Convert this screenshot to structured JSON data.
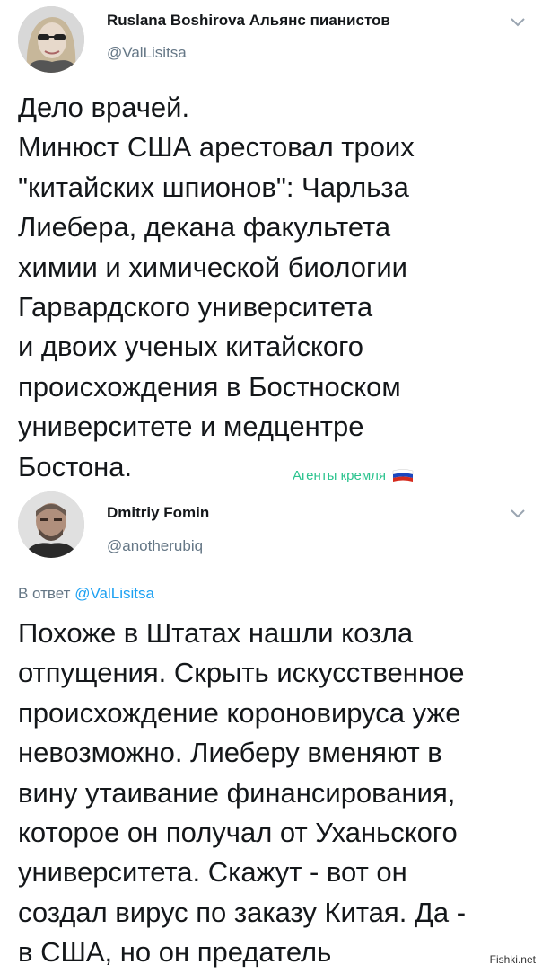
{
  "tweets": [
    {
      "author_name": "Ruslana Boshirova Альянс пианистов",
      "handle": "@ValLisitsa",
      "text": "Дело врачей.\nМинюст США арестовал троих\n\"китайских шпионов\": Чарльза\nЛиебера, декана факультета\nхимии и химической биологии\nГарвардского университета\nи двоих ученых китайского\nпроисхождения в Бостноском\nуниверситете и медцентре\nБостона.",
      "stamp": "Агенты кремля"
    },
    {
      "author_name": "Dmitriy Fomin",
      "handle": "@anotherubiq",
      "reply_prefix": "В ответ",
      "reply_to": "@ValLisitsa",
      "text": "Похоже в Штатах нашли козла\nотпущения. Скрыть искусственное\nпроисхождение короновируса уже\nневозможно. Лиеберу вменяют в\nвину утаивание финансирования,\nкоторое он получал от Уханьского\nуниверситета. Скажут -  вот  он\nсоздал вирус по заказу Китая. Да -\nв США, но он предатель"
    }
  ],
  "watermark": "Fishki.net",
  "colors": {
    "text": "#14171a",
    "secondary": "#657786",
    "link": "#1da1f2",
    "stamp": "#2bc38e"
  },
  "icons": [
    "avatar",
    "chevron-down-icon",
    "russian-flag-icon"
  ]
}
